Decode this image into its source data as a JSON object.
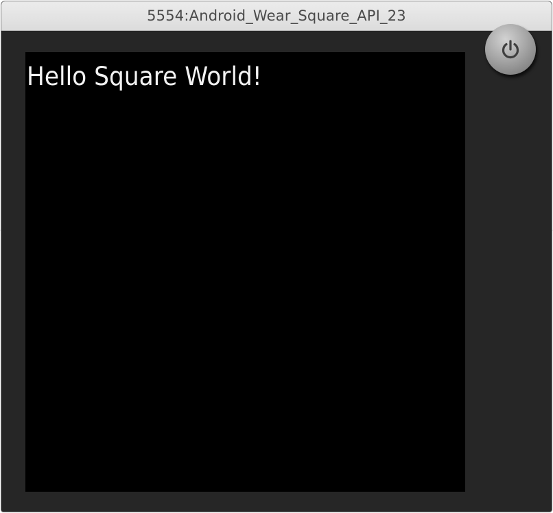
{
  "window": {
    "title": "5554:Android_Wear_Square_API_23"
  },
  "screen": {
    "text": "Hello Square World!"
  },
  "controls": {
    "power_icon": "power-icon"
  },
  "colors": {
    "titlebar": "#e3e3e3",
    "frame": "#262626",
    "screen": "#000000",
    "screen_text": "#f2f2f2",
    "power_button": "#a6a6a6"
  }
}
